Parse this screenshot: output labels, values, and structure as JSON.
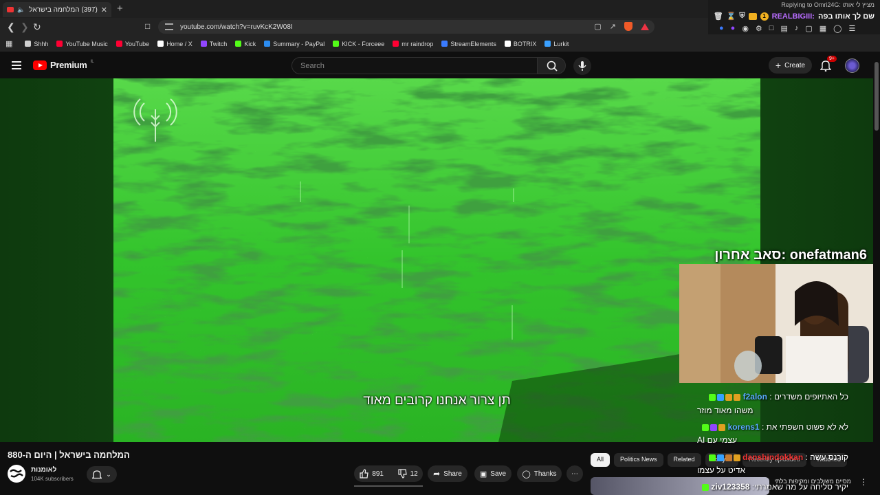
{
  "browser": {
    "tab_title": "(397) המלחמה בישראל | היום",
    "url": "youtube.com/watch?v=ruvKcK2W08I"
  },
  "bookmarks": [
    {
      "label": "Shhh",
      "color": "#cfcfcf"
    },
    {
      "label": "YouTube Music",
      "color": "#ff0033"
    },
    {
      "label": "YouTube",
      "color": "#ff0033"
    },
    {
      "label": "Home / X",
      "color": "#ffffff"
    },
    {
      "label": "Twitch",
      "color": "#9146ff"
    },
    {
      "label": "Kick",
      "color": "#53fc18"
    },
    {
      "label": "Summary - PayPal",
      "color": "#2c8cf0"
    },
    {
      "label": "KICK - Forceee",
      "color": "#53fc18"
    },
    {
      "label": "mr raindrop",
      "color": "#ff0033"
    },
    {
      "label": "StreamElements",
      "color": "#3a7bff"
    },
    {
      "label": "BOTRIX",
      "color": "#ffffff"
    },
    {
      "label": "Lurkit",
      "color": "#3aa0ff"
    }
  ],
  "youtube": {
    "logo_text": "Premium",
    "logo_region": "IL",
    "search_placeholder": "Search",
    "create_label": "Create",
    "notification_count": "9+"
  },
  "video": {
    "caption": "תן צרור אנחנו קרובים מאוד",
    "title": "המלחמה בישראל | היום ה-880",
    "channel_name": "לאומנות",
    "subscribers": "104K subscribers",
    "likes": "891",
    "dislikes": "12",
    "share_label": "Share",
    "save_label": "Save",
    "thanks_label": "Thanks"
  },
  "overlay": {
    "reply_line": "Replying to Omri24G: מציץ לי אותו",
    "top_user": "REALBIGIII:",
    "top_msg": "שם לך אותו בפה",
    "top_badge_num": "1",
    "sub_banner": "סאב אחרון: onefatman6",
    "chat": [
      {
        "user": "f2alon",
        "msg": "כל האתיופים משדרים :",
        "line2": "משהו מאוד מוזר",
        "user_color": "#5aa9ff"
      },
      {
        "user": "korens1",
        "msg": "לא לא פשוט חשפתי את :",
        "line2": "עצמי עם AI",
        "user_color": "#5aa9ff"
      },
      {
        "user": "danshindokkan",
        "msg": "קורנס עשה :",
        "line2": "אדיט על עצמו",
        "user_color": "#e33"
      },
      {
        "user": "ziv123358",
        "msg": "יקיר סליחה על מה שאמרתי:",
        "line2": "",
        "user_color": "#ffffff"
      }
    ]
  },
  "chips": [
    "All",
    "Politics News",
    "Related",
    "For you",
    "Recently uploaded",
    "Watched"
  ],
  "recommended_title": "מסיים משולבים ומקיפות בלתי"
}
